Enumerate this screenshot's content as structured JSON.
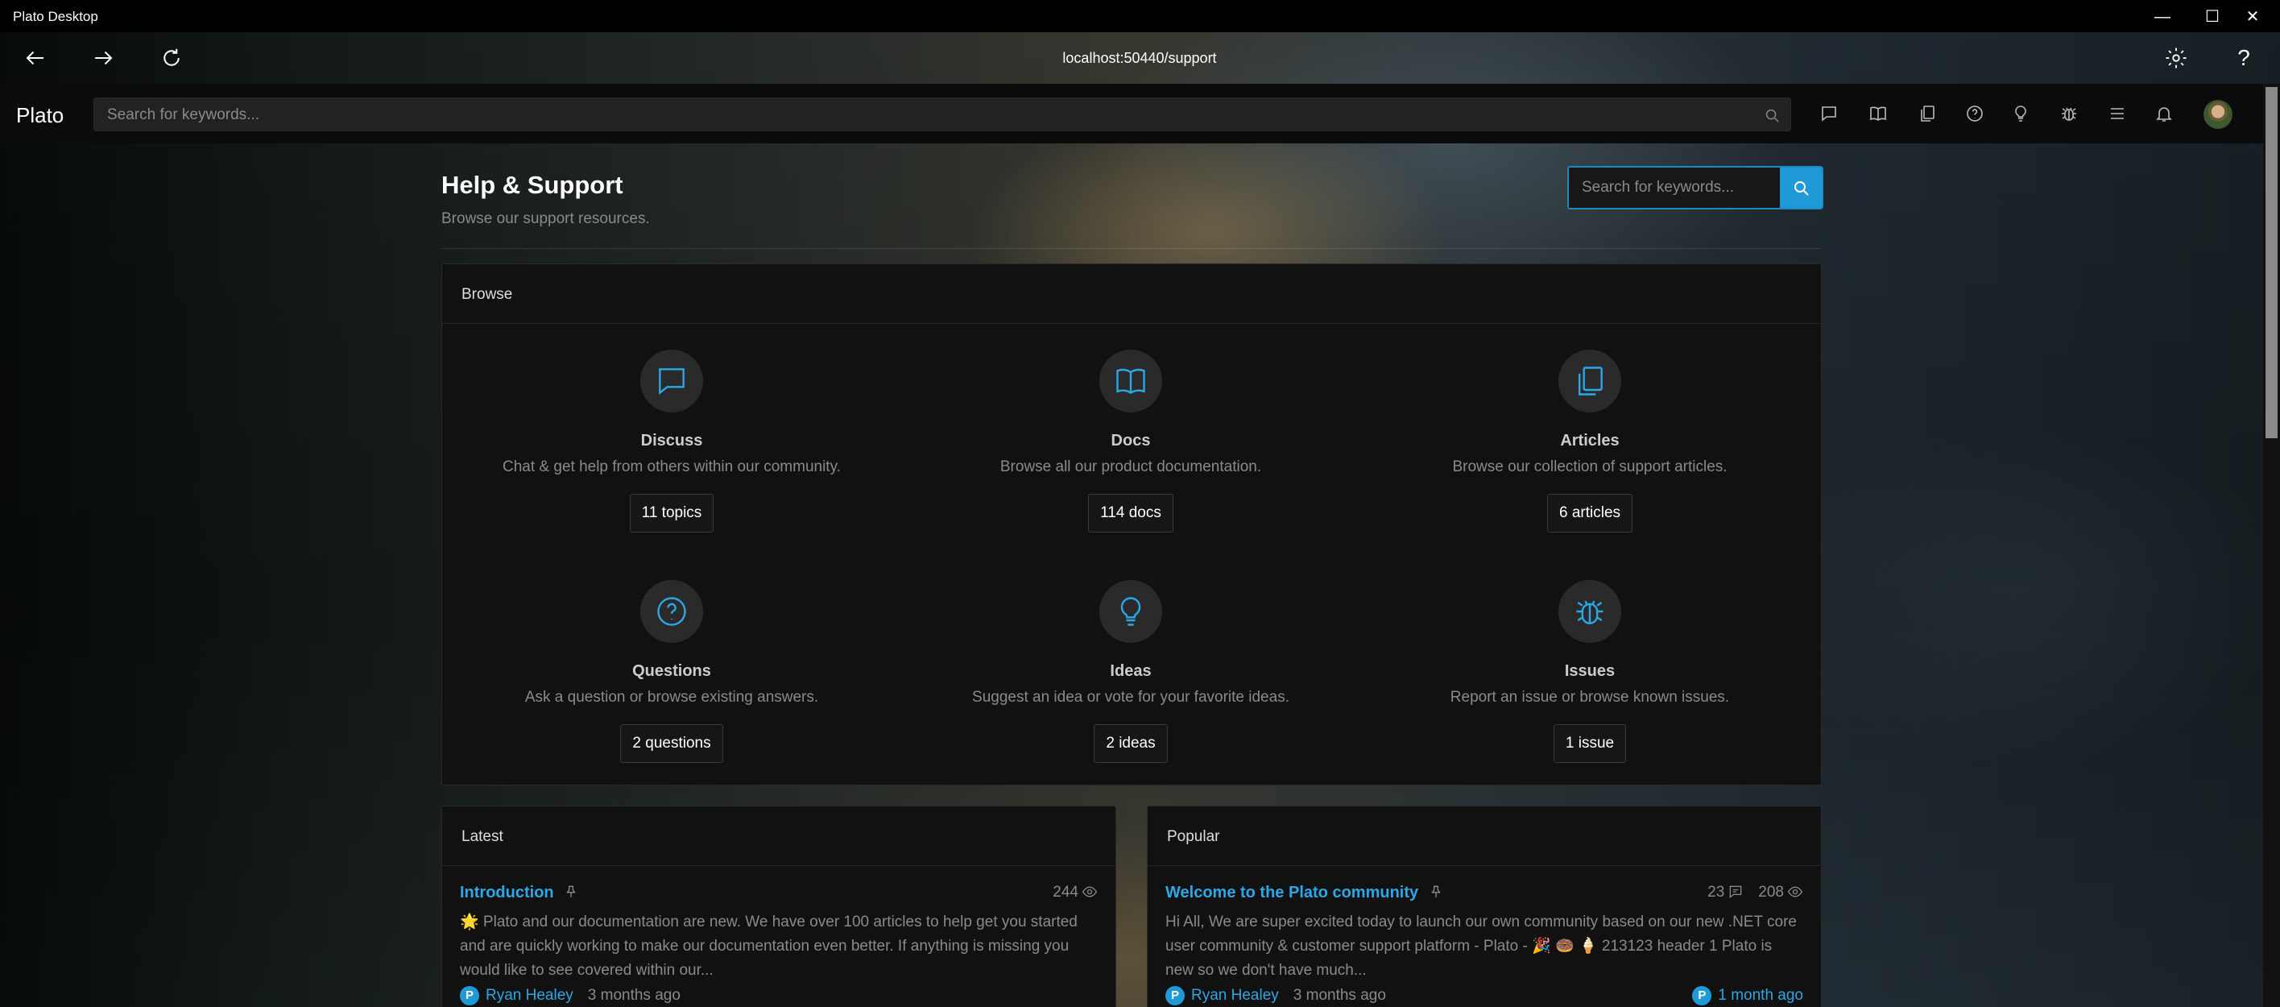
{
  "window": {
    "title": "Plato Desktop",
    "controls": {
      "minimize": "—",
      "maximize": "☐",
      "close": "✕"
    }
  },
  "browser": {
    "url": "localhost:50440/support"
  },
  "header": {
    "brand": "Plato",
    "search_placeholder": "Search for keywords...",
    "icons": [
      "chat-icon",
      "book-icon",
      "copy-icon",
      "question-icon",
      "lightbulb-icon",
      "bug-icon",
      "menu-icon",
      "bell-icon"
    ]
  },
  "page": {
    "title": "Help & Support",
    "subtitle": "Browse our support resources.",
    "search_placeholder": "Search for keywords..."
  },
  "browse": {
    "heading": "Browse",
    "tiles": [
      {
        "name": "Discuss",
        "desc": "Chat & get help from others within our community.",
        "count": "11 topics",
        "icon": "chat-icon"
      },
      {
        "name": "Docs",
        "desc": "Browse all our product documentation.",
        "count": "114 docs",
        "icon": "book-icon"
      },
      {
        "name": "Articles",
        "desc": "Browse our collection of support articles.",
        "count": "6 articles",
        "icon": "copy-icon"
      },
      {
        "name": "Questions",
        "desc": "Ask a question or browse existing answers.",
        "count": "2 questions",
        "icon": "question-icon"
      },
      {
        "name": "Ideas",
        "desc": "Suggest an idea or vote for your favorite ideas.",
        "count": "2 ideas",
        "icon": "lightbulb-icon"
      },
      {
        "name": "Issues",
        "desc": "Report an issue or browse known issues.",
        "count": "1 issue",
        "icon": "bug-icon"
      }
    ]
  },
  "latest": {
    "heading": "Latest",
    "entry": {
      "title": "Introduction",
      "views": "244",
      "text": "🌟 Plato and our documentation are new. We have over 100 articles to help get you started and are quickly working to make our documentation even better. If anything is missing you would like to see covered within our...",
      "author": "Ryan Healey",
      "ago": "3 months ago"
    }
  },
  "popular": {
    "heading": "Popular",
    "entry": {
      "title": "Welcome to the Plato community",
      "replies": "23",
      "views": "208",
      "text": "Hi All, We are super excited today to launch our own community based on our new .NET core user community & customer support platform - Plato - 🎉 🍩 🍦 213123 header 1 Plato is new so we don't have much...",
      "author": "Ryan Healey",
      "ago": "3 months ago",
      "last_reply": "1 month ago"
    }
  },
  "colors": {
    "accent": "#2aa8e8",
    "search_button": "#1f9ad6"
  }
}
